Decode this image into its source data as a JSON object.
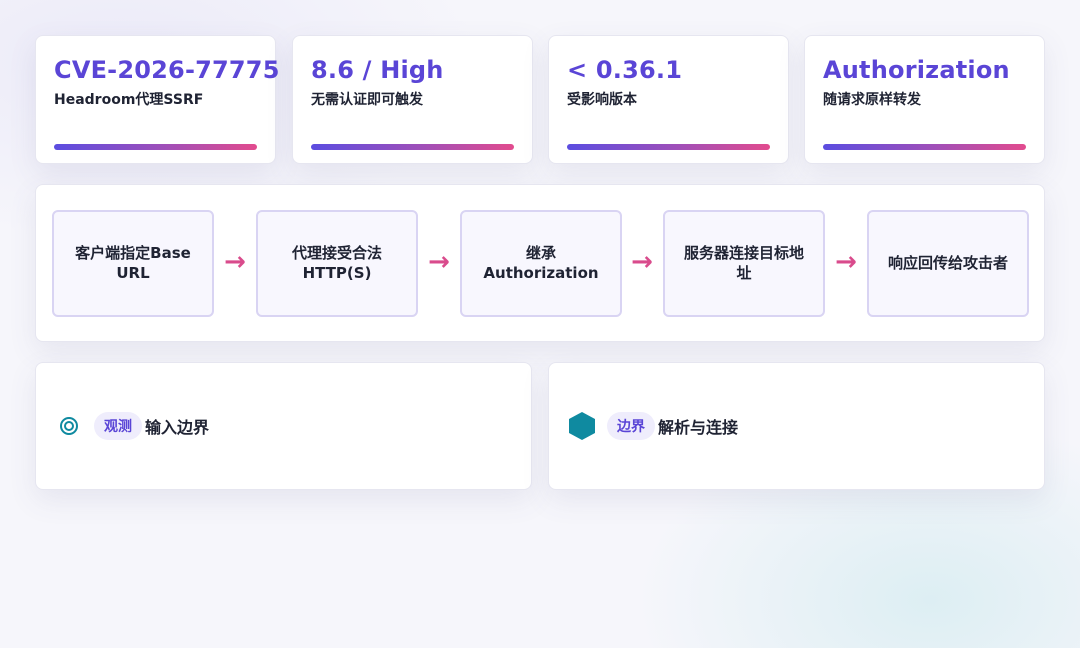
{
  "stats": [
    {
      "value": "CVE-2026-77775",
      "label": "Headroom代理SSRF"
    },
    {
      "value": "8.6 / High",
      "label": "无需认证即可触发"
    },
    {
      "value": "< 0.36.1",
      "label": "受影响版本"
    },
    {
      "value": "Authorization",
      "label": "随请求原样转发"
    }
  ],
  "flow": {
    "steps": [
      "客户端指定Base URL",
      "代理接受合法 HTTP(S)",
      "继承 Authorization",
      "服务器连接目标地址",
      "响应回传给攻击者"
    ],
    "arrow": "→"
  },
  "panels": [
    {
      "icon": "target-icon",
      "tag": "观测",
      "title": "输入边界"
    },
    {
      "icon": "hexagon-icon",
      "tag": "边界",
      "title": "解析与连接"
    }
  ],
  "colors": {
    "accent": "#5a45d6",
    "arrow": "#d94b8c",
    "gradient_start": "#5b4de0",
    "gradient_end": "#e24b8e",
    "teal": "#0f8aa0"
  }
}
